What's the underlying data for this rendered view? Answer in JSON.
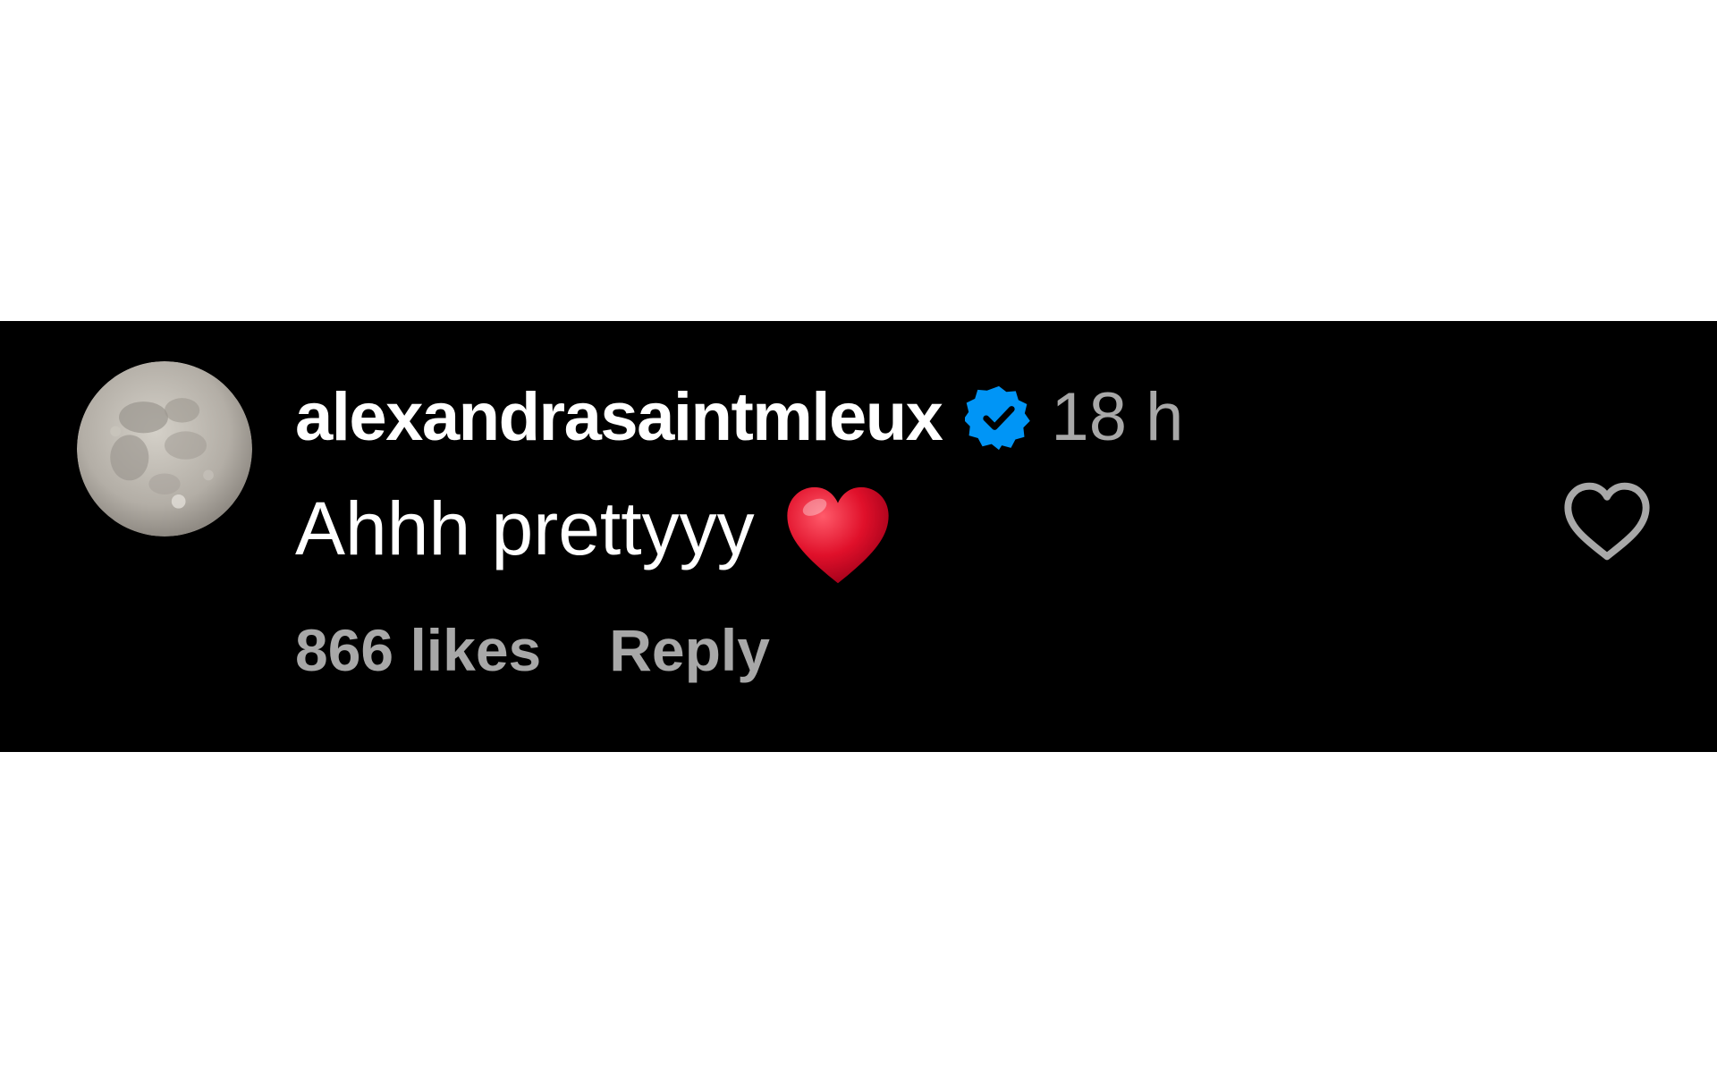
{
  "comment": {
    "username": "alexandrasaintmleux",
    "verified_icon": "verified-badge-icon",
    "timestamp": "18 h",
    "text": "Ahhh prettyyy",
    "emoji_icon": "red-heart-emoji-icon",
    "likes_label": "866 likes",
    "reply_label": "Reply",
    "like_icon": "heart-outline-icon",
    "avatar_icon": "full-moon-avatar"
  },
  "colors": {
    "background": "#000000",
    "page_margin": "#ffffff",
    "primary_text": "#ffffff",
    "secondary_text": "#a8a8a8",
    "verified_blue": "#0095f6",
    "heart_red": "#e0102a"
  }
}
